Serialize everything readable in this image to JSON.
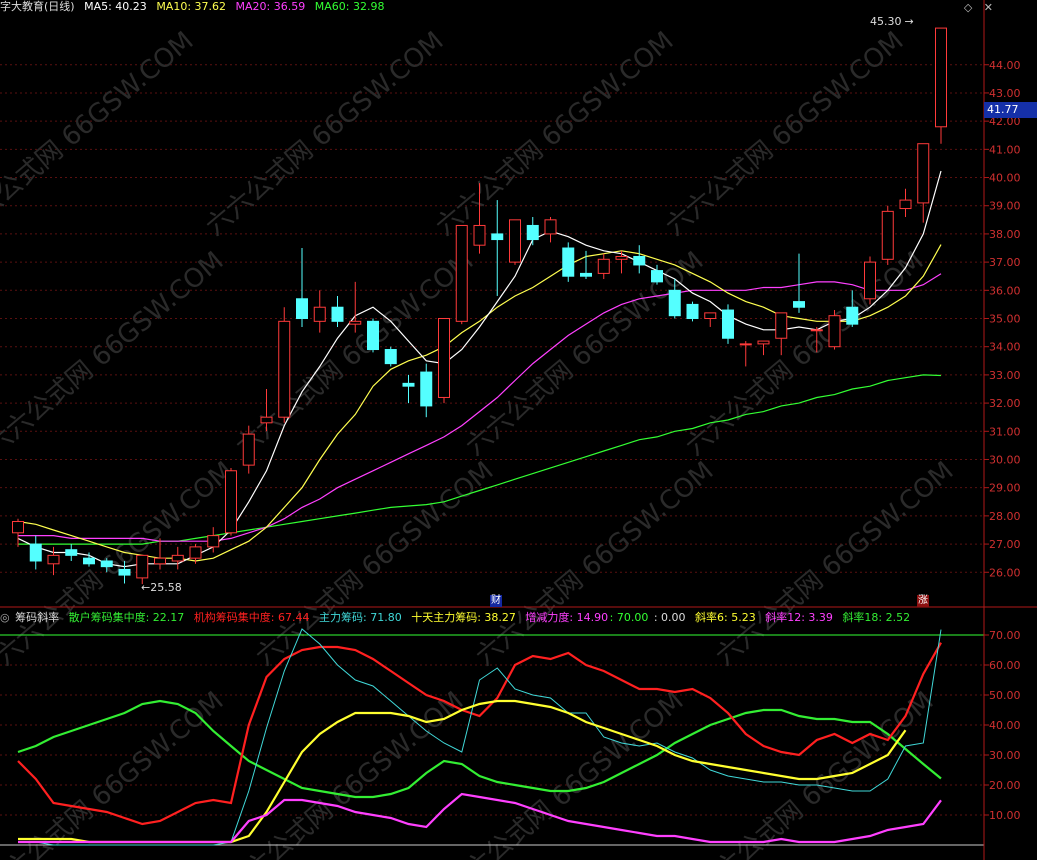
{
  "header": {
    "title": "字大教育(日线)",
    "ma5": "MA5: 40.23",
    "ma10": "MA10: 37.62",
    "ma20": "MA20: 36.59",
    "ma60": "MA60: 32.98",
    "icons": [
      "diamond-icon",
      "close-icon"
    ]
  },
  "price_panel": {
    "current_price_tag": "41.77",
    "high_label": "45.30",
    "low_label": "25.58",
    "y_ticks": [
      "44.00",
      "43.00",
      "42.00",
      "41.00",
      "40.00",
      "39.00",
      "38.00",
      "37.00",
      "36.00",
      "35.00",
      "34.00",
      "33.00",
      "32.00",
      "31.00",
      "30.00",
      "29.00",
      "28.00",
      "27.00",
      "26.00"
    ],
    "marker_cai": "财",
    "marker_zhang": "涨"
  },
  "indicator_panel": {
    "title": "筹码斜率",
    "label_retail": "散户筹码集中度: 22.17",
    "label_inst": "机构筹码集中度: 67.44",
    "label_main": "主力筹码: 71.80",
    "label_ten": "十天主力筹码: 38.27",
    "label_force": "增减力度: 14.90",
    "label_const": ": 70.00",
    "label_zero": ": 0.00",
    "label_slope6": "斜率6: 5.23",
    "label_slope12": "斜率12: 3.39",
    "label_slope18": "斜率18: 2.52",
    "y_ticks": [
      "70.00",
      "60.00",
      "50.00",
      "40.00",
      "30.00",
      "20.00",
      "10.00"
    ]
  },
  "watermark": "六六公式网 66GSW.COM",
  "colors": {
    "up": "#ff3a3a",
    "down": "#54ffff",
    "ma5": "#ffffff",
    "ma10": "#ffff50",
    "ma20": "#ff40ff",
    "ma60": "#33ff33",
    "axis": "#b01818",
    "retail": "#33ee33",
    "inst": "#ff2020",
    "main": "#40d8d8",
    "ten": "#ffff30",
    "force": "#ff40ff"
  },
  "chart_data": [
    {
      "type": "candlestick",
      "title": "字大教育(日线)",
      "ylim": [
        25.3,
        45.8
      ],
      "candles": [
        {
          "o": 27.4,
          "h": 27.9,
          "l": 26.9,
          "c": 27.8
        },
        {
          "o": 27.0,
          "h": 27.3,
          "l": 26.1,
          "c": 26.4
        },
        {
          "o": 26.3,
          "h": 26.9,
          "l": 25.9,
          "c": 26.6
        },
        {
          "o": 26.8,
          "h": 27.0,
          "l": 26.4,
          "c": 26.6
        },
        {
          "o": 26.5,
          "h": 26.7,
          "l": 26.2,
          "c": 26.3
        },
        {
          "o": 26.4,
          "h": 26.5,
          "l": 26.0,
          "c": 26.2
        },
        {
          "o": 26.1,
          "h": 26.4,
          "l": 25.6,
          "c": 25.9
        },
        {
          "o": 25.8,
          "h": 26.6,
          "l": 25.58,
          "c": 26.6
        },
        {
          "o": 26.3,
          "h": 27.2,
          "l": 26.1,
          "c": 26.5
        },
        {
          "o": 26.4,
          "h": 26.9,
          "l": 26.1,
          "c": 26.6
        },
        {
          "o": 26.5,
          "h": 27.0,
          "l": 26.3,
          "c": 26.9
        },
        {
          "o": 26.9,
          "h": 27.6,
          "l": 26.7,
          "c": 27.3
        },
        {
          "o": 27.4,
          "h": 29.7,
          "l": 27.3,
          "c": 29.6
        },
        {
          "o": 29.8,
          "h": 31.2,
          "l": 29.5,
          "c": 30.9
        },
        {
          "o": 31.3,
          "h": 32.5,
          "l": 31.0,
          "c": 31.5
        },
        {
          "o": 31.5,
          "h": 35.4,
          "l": 31.3,
          "c": 34.9
        },
        {
          "o": 35.7,
          "h": 37.5,
          "l": 34.7,
          "c": 35.0
        },
        {
          "o": 34.9,
          "h": 36.0,
          "l": 34.5,
          "c": 35.4
        },
        {
          "o": 35.4,
          "h": 35.8,
          "l": 34.7,
          "c": 34.9
        },
        {
          "o": 34.8,
          "h": 36.3,
          "l": 34.5,
          "c": 34.9
        },
        {
          "o": 34.9,
          "h": 35.0,
          "l": 33.8,
          "c": 33.9
        },
        {
          "o": 33.9,
          "h": 34.0,
          "l": 33.3,
          "c": 33.4
        },
        {
          "o": 32.7,
          "h": 33.0,
          "l": 32.0,
          "c": 32.6
        },
        {
          "o": 33.1,
          "h": 33.4,
          "l": 31.5,
          "c": 31.9
        },
        {
          "o": 32.2,
          "h": 33.6,
          "l": 32.0,
          "c": 35.0
        },
        {
          "o": 34.9,
          "h": 38.3,
          "l": 34.8,
          "c": 38.3
        },
        {
          "o": 37.6,
          "h": 39.8,
          "l": 37.3,
          "c": 38.3
        },
        {
          "o": 38.0,
          "h": 39.2,
          "l": 35.8,
          "c": 37.8
        },
        {
          "o": 37.0,
          "h": 38.5,
          "l": 36.9,
          "c": 38.5
        },
        {
          "o": 38.3,
          "h": 38.6,
          "l": 37.6,
          "c": 37.8
        },
        {
          "o": 38.0,
          "h": 38.6,
          "l": 37.7,
          "c": 38.5
        },
        {
          "o": 37.5,
          "h": 37.7,
          "l": 36.3,
          "c": 36.5
        },
        {
          "o": 36.6,
          "h": 37.4,
          "l": 36.4,
          "c": 36.5
        },
        {
          "o": 36.6,
          "h": 37.3,
          "l": 36.4,
          "c": 37.1
        },
        {
          "o": 37.1,
          "h": 37.4,
          "l": 36.6,
          "c": 37.2
        },
        {
          "o": 37.2,
          "h": 37.6,
          "l": 36.6,
          "c": 36.9
        },
        {
          "o": 36.7,
          "h": 36.9,
          "l": 36.2,
          "c": 36.3
        },
        {
          "o": 36.0,
          "h": 36.4,
          "l": 35.0,
          "c": 35.1
        },
        {
          "o": 35.5,
          "h": 35.6,
          "l": 34.9,
          "c": 35.0
        },
        {
          "o": 35.0,
          "h": 35.2,
          "l": 34.7,
          "c": 35.2
        },
        {
          "o": 35.3,
          "h": 35.5,
          "l": 34.1,
          "c": 34.3
        },
        {
          "o": 34.1,
          "h": 34.2,
          "l": 33.3,
          "c": 34.1
        },
        {
          "o": 34.1,
          "h": 34.2,
          "l": 33.7,
          "c": 34.2
        },
        {
          "o": 34.3,
          "h": 35.2,
          "l": 33.7,
          "c": 35.2
        },
        {
          "o": 35.6,
          "h": 37.3,
          "l": 35.2,
          "c": 35.4
        },
        {
          "o": 34.6,
          "h": 34.7,
          "l": 33.8,
          "c": 34.6
        },
        {
          "o": 34.0,
          "h": 35.3,
          "l": 33.9,
          "c": 35.1
        },
        {
          "o": 35.4,
          "h": 36.0,
          "l": 34.7,
          "c": 34.8
        },
        {
          "o": 35.7,
          "h": 37.2,
          "l": 35.5,
          "c": 37.0
        },
        {
          "o": 37.1,
          "h": 39.0,
          "l": 36.9,
          "c": 38.8
        },
        {
          "o": 38.9,
          "h": 39.6,
          "l": 38.6,
          "c": 39.2
        },
        {
          "o": 39.1,
          "h": 41.2,
          "l": 38.4,
          "c": 41.2
        },
        {
          "o": 41.8,
          "h": 45.3,
          "l": 41.2,
          "c": 45.3
        }
      ],
      "ma5": [
        27.2,
        26.9,
        26.7,
        26.7,
        26.6,
        26.3,
        26.2,
        26.3,
        26.3,
        26.3,
        26.6,
        26.9,
        27.5,
        28.5,
        29.6,
        31.2,
        32.4,
        33.3,
        34.3,
        35.1,
        35.4,
        34.9,
        34.2,
        33.5,
        33.4,
        33.9,
        34.7,
        35.6,
        36.5,
        37.8,
        38.1,
        37.9,
        37.6,
        37.4,
        37.3,
        37.0,
        36.7,
        36.4,
        35.9,
        35.6,
        35.1,
        34.8,
        34.6,
        34.6,
        34.7,
        34.6,
        34.9,
        35.0,
        35.4,
        36.0,
        36.8,
        38.0,
        40.23
      ],
      "ma10": [
        27.8,
        27.7,
        27.5,
        27.3,
        27.1,
        26.9,
        26.7,
        26.6,
        26.5,
        26.5,
        26.4,
        26.5,
        26.8,
        27.1,
        27.6,
        28.3,
        29.0,
        30.0,
        30.9,
        31.6,
        32.6,
        33.2,
        33.5,
        33.7,
        34.0,
        34.5,
        34.9,
        35.4,
        35.8,
        36.1,
        36.5,
        36.9,
        37.2,
        37.3,
        37.4,
        37.3,
        37.1,
        36.9,
        36.6,
        36.3,
        35.9,
        35.6,
        35.4,
        35.1,
        35.0,
        34.9,
        34.9,
        34.9,
        35.1,
        35.4,
        35.8,
        36.5,
        37.62
      ],
      "ma20": [
        27.3,
        27.3,
        27.3,
        27.2,
        27.2,
        27.2,
        27.2,
        27.2,
        27.1,
        27.1,
        27.1,
        27.1,
        27.2,
        27.4,
        27.6,
        27.9,
        28.3,
        28.6,
        29.0,
        29.3,
        29.6,
        29.9,
        30.2,
        30.5,
        30.8,
        31.2,
        31.7,
        32.2,
        32.8,
        33.4,
        33.9,
        34.4,
        34.8,
        35.2,
        35.5,
        35.7,
        35.8,
        35.9,
        36.0,
        36.0,
        36.0,
        36.0,
        36.1,
        36.1,
        36.2,
        36.3,
        36.3,
        36.2,
        36.0,
        36.0,
        36.0,
        36.2,
        36.59
      ],
      "ma60": [
        27.0,
        27.0,
        27.0,
        27.0,
        27.0,
        27.0,
        27.0,
        27.0,
        27.1,
        27.1,
        27.2,
        27.3,
        27.4,
        27.5,
        27.6,
        27.7,
        27.8,
        27.9,
        28.0,
        28.1,
        28.2,
        28.3,
        28.35,
        28.4,
        28.5,
        28.7,
        28.9,
        29.1,
        29.3,
        29.5,
        29.7,
        29.9,
        30.1,
        30.3,
        30.5,
        30.7,
        30.8,
        31.0,
        31.1,
        31.3,
        31.4,
        31.6,
        31.7,
        31.9,
        32.0,
        32.2,
        32.3,
        32.5,
        32.6,
        32.8,
        32.9,
        33.0,
        32.98
      ]
    },
    {
      "type": "line",
      "title": "筹码斜率",
      "ylim": [
        0,
        70
      ],
      "x": [
        0,
        1,
        2,
        3,
        4,
        5,
        6,
        7,
        8,
        9,
        10,
        11,
        12,
        13,
        14,
        15,
        16,
        17,
        18,
        19,
        20,
        21,
        22,
        23,
        24,
        25,
        26,
        27,
        28,
        29,
        30,
        31,
        32,
        33,
        34,
        35,
        36,
        37,
        38,
        39,
        40,
        41,
        42,
        43,
        44,
        45,
        46,
        47,
        48,
        49,
        50,
        51,
        52
      ],
      "series": [
        {
          "name": "散户筹码集中度",
          "values": [
            31,
            33,
            36,
            38,
            40,
            42,
            44,
            47,
            48,
            47,
            44,
            38,
            33,
            28,
            25,
            22,
            19,
            18,
            17,
            16,
            16,
            17,
            19,
            24,
            28,
            27,
            23,
            21,
            20,
            19,
            18,
            18,
            19,
            21,
            24,
            27,
            30,
            34,
            37,
            40,
            42,
            44,
            45,
            45,
            43,
            42,
            42,
            41,
            41,
            37,
            32,
            27,
            22.17
          ]
        },
        {
          "name": "机构筹码集中度",
          "values": [
            28,
            22,
            14,
            13,
            12,
            11,
            9,
            7,
            8,
            11,
            14,
            15,
            14,
            40,
            56,
            62,
            65,
            66,
            66,
            65,
            62,
            58,
            54,
            50,
            48,
            45,
            43,
            49,
            60,
            63,
            62,
            64,
            60,
            58,
            55,
            52,
            52,
            51,
            52,
            49,
            44,
            37,
            33,
            31,
            30,
            35,
            37,
            34,
            37,
            35,
            43,
            57,
            67.44
          ]
        },
        {
          "name": "主力筹码",
          "values": [
            1,
            1,
            0,
            0,
            0,
            0,
            0,
            0,
            0,
            0,
            0,
            0,
            1,
            18,
            39,
            58,
            72,
            67,
            60,
            55,
            53,
            48,
            43,
            38,
            34,
            31,
            55,
            59,
            52,
            50,
            49,
            44,
            44,
            36,
            34,
            33,
            34,
            31,
            29,
            25,
            23,
            22,
            21,
            21,
            20,
            20,
            19,
            18,
            18,
            22,
            33,
            34,
            71.8
          ]
        },
        {
          "name": "十天主力筹码",
          "values": [
            2,
            2,
            2,
            2,
            1,
            1,
            1,
            1,
            1,
            1,
            1,
            1,
            1,
            3,
            11,
            21,
            31,
            37,
            41,
            44,
            44,
            44,
            43,
            41,
            42,
            45,
            47,
            48,
            48,
            47,
            46,
            44,
            41,
            39,
            37,
            35,
            33,
            30,
            28,
            27,
            26,
            25,
            24,
            23,
            22,
            22,
            23,
            24,
            27,
            30,
            38.27
          ]
        },
        {
          "name": "增减力度",
          "values": [
            1,
            1,
            1,
            1,
            1,
            1,
            1,
            1,
            1,
            1,
            1,
            1,
            1,
            8,
            10,
            15,
            15,
            14,
            13,
            11,
            10,
            9,
            7,
            6,
            12,
            17,
            16,
            15,
            14,
            12,
            10,
            8,
            7,
            6,
            5,
            4,
            3,
            3,
            2,
            1,
            1,
            1,
            1,
            2,
            1,
            1,
            1,
            2,
            3,
            5,
            6,
            7,
            14.9
          ]
        }
      ]
    }
  ]
}
